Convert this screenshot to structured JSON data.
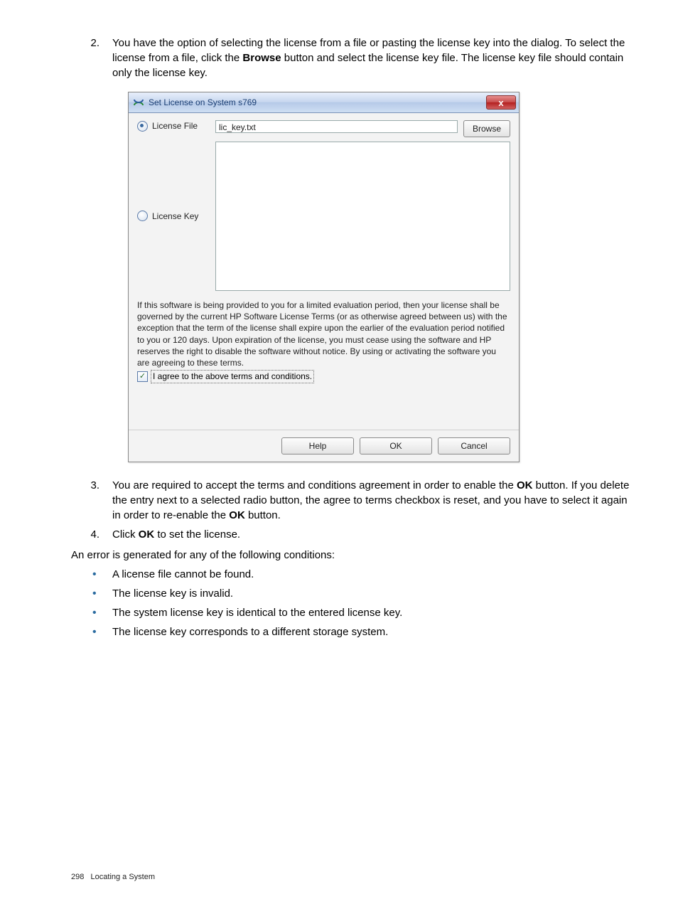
{
  "steps": {
    "s2": {
      "num": "2.",
      "text_prefix": "You have the option of selecting the license from a file or pasting the license key into the dialog. To select the license from a file, click the ",
      "bold1": "Browse",
      "text_suffix": " button and select the license key file. The license key file should contain only the license key."
    },
    "s3": {
      "num": "3.",
      "text_prefix": "You are required to accept the terms and conditions agreement in order to enable the ",
      "bold1": "OK",
      "text_mid": " button. If you delete the entry next to a selected radio button, the agree to terms checkbox is reset, and you have to select it again in order to re-enable the ",
      "bold2": "OK",
      "text_suffix": " button."
    },
    "s4": {
      "num": "4.",
      "text_prefix": "Click ",
      "bold1": "OK",
      "text_suffix": " to set the license."
    }
  },
  "dialog": {
    "title": "Set License on System s769",
    "radio_file_label": "License File",
    "radio_key_label": "License Key",
    "file_value": "lic_key.txt",
    "browse_label": "Browse",
    "terms": "If this software is being provided to you for a limited evaluation period, then your license shall be governed by the current HP Software License Terms (or as otherwise agreed between us) with the exception that the term of the license shall expire upon the earlier of the evaluation period notified to you or 120 days. Upon expiration of the license, you must cease using the software and HP reserves the right to disable the software without notice. By using or activating the software you are agreeing to these terms.",
    "agree_label": "I agree to the above terms and conditions.",
    "buttons": {
      "help": "Help",
      "ok": "OK",
      "cancel": "Cancel"
    }
  },
  "errors_intro": "An error is generated for any of the following conditions:",
  "errors": [
    "A license file cannot be found.",
    "The license key is invalid.",
    "The system license key is identical to the entered license key.",
    "The license key corresponds to a different storage system."
  ],
  "footer": {
    "page": "298",
    "section": "Locating a System"
  }
}
